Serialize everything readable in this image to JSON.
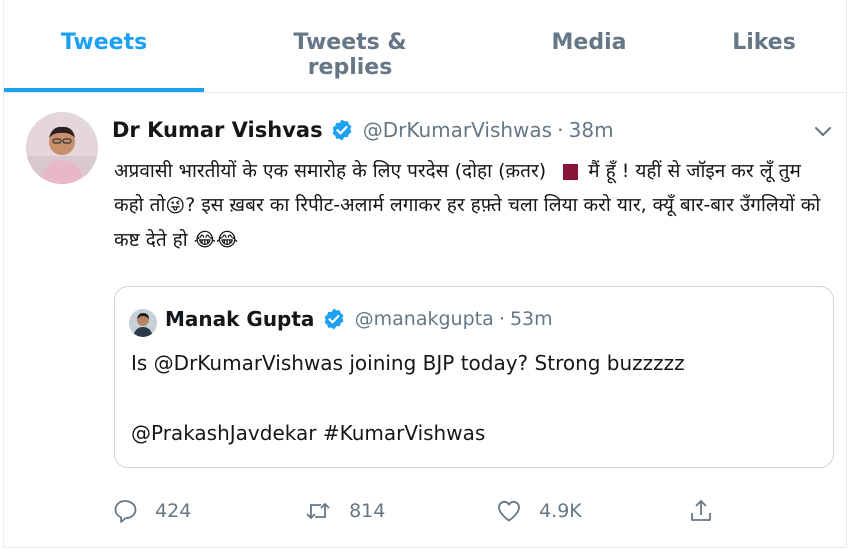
{
  "tabs": [
    {
      "label": "Tweets",
      "active": true
    },
    {
      "label": "Tweets & replies",
      "active": false
    },
    {
      "label": "Media",
      "active": false
    },
    {
      "label": "Likes",
      "active": false
    }
  ],
  "tweet": {
    "author_name": "Dr Kumar Vishvas",
    "handle": "@DrKumarVishwas",
    "separator": "·",
    "time": "38m",
    "text_part1": "अप्रवासी भारतीयों के एक समारोह के लिए परदेस (दोहा (क़तर)",
    "text_part2": "मैं हूँ ! यहीं से जॉइन कर लूँ तुम कहो तो",
    "text_part3": "? इस ख़बर का रिपीट-अलार्म लगाकर हर हफ़्ते चला लिया करो यार, क्यूँ बार-बार उँगलियों को कष्ट देते हो",
    "emoji_wink": "😜",
    "emoji_laugh": "😂😂",
    "flag_icon": "qatar-flag",
    "menu_icon": "chevron-down-icon"
  },
  "quoted": {
    "author_name": "Manak Gupta",
    "handle": "@manakgupta",
    "separator": "·",
    "time": "53m",
    "line1": "Is @DrKumarVishwas joining BJP today? Strong buzzzzz",
    "line2": "@PrakashJavdekar #KumarVishwas"
  },
  "actions": {
    "reply_count": "424",
    "retweet_count": "814",
    "like_count": "4.9K"
  },
  "colors": {
    "accent": "#1da1f2",
    "secondary_text": "#657786",
    "border": "#e6ecf0"
  }
}
